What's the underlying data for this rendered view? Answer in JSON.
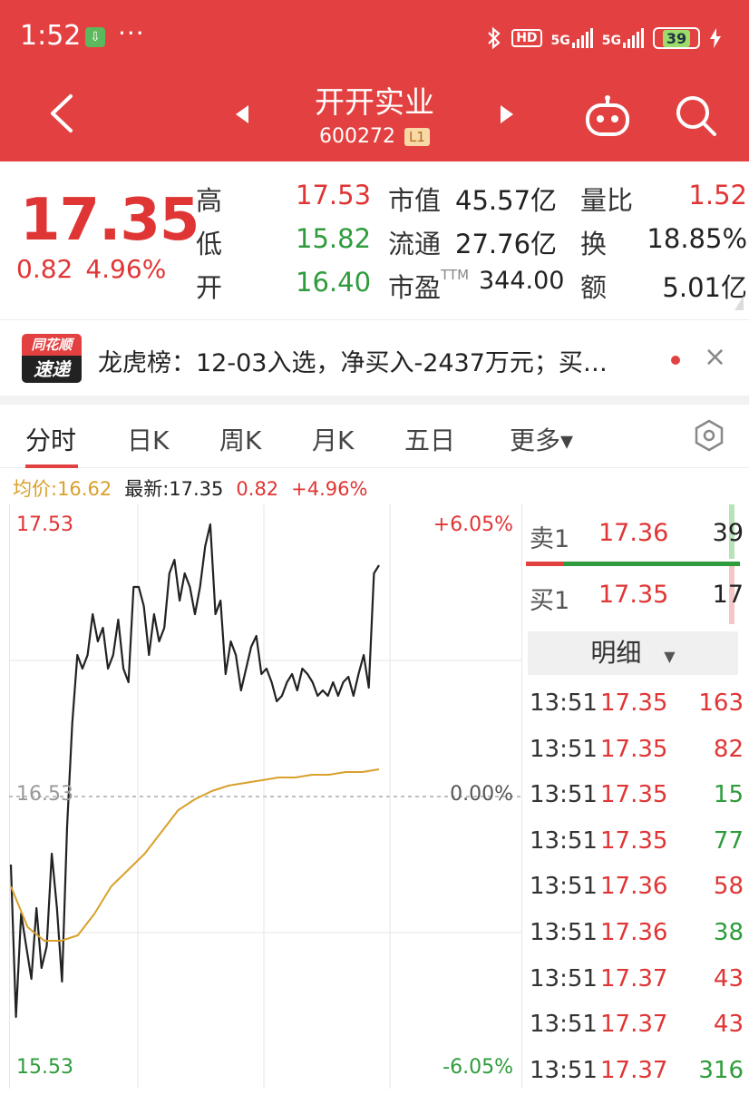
{
  "status_bar": {
    "time": "1:52",
    "battery": "39",
    "network1": "5G",
    "network2": "5G",
    "hd": "HD",
    "icons": [
      "download-icon",
      "more-dots-icon",
      "bluetooth-icon",
      "hd-icon",
      "signal-icon",
      "battery-icon",
      "charging-icon"
    ]
  },
  "header": {
    "stock_name": "开开实业",
    "stock_code": "600272",
    "level": "L1",
    "colors": {
      "header_bg": "#e34141"
    }
  },
  "quote": {
    "price": "17.35",
    "change": "0.82",
    "change_pct": "4.96%",
    "high_label": "高",
    "high": "17.53",
    "low_label": "低",
    "low": "15.82",
    "open_label": "开",
    "open": "16.40",
    "mktcap_label": "市值",
    "mktcap": "45.57亿",
    "float_label": "流通",
    "float": "27.76亿",
    "pe_label": "市盈",
    "pe_sup": "TTM",
    "pe": "344.00",
    "vol_ratio_label": "量比",
    "vol_ratio": "1.52",
    "turnover_label": "换",
    "turnover": "18.85%",
    "amount_label": "额",
    "amount": "5.01亿"
  },
  "news": {
    "logo_top": "同花顺",
    "logo_bottom": "速递",
    "text": "龙虎榜：12-03入选，净买入-2437万元；买…",
    "close": "×"
  },
  "tabs": [
    {
      "label": "分时"
    },
    {
      "label": "日K"
    },
    {
      "label": "周K"
    },
    {
      "label": "月K"
    },
    {
      "label": "五日"
    },
    {
      "label": "更多▾"
    }
  ],
  "infoline": {
    "avg_label": "均价:16.62",
    "latest_label": "最新:17.35",
    "change": "0.82",
    "change_pct": "+4.96%"
  },
  "chart_labels": {
    "y_top": "17.53",
    "y_mid": "16.53",
    "y_bottom": "15.53",
    "pct_top": "+6.05%",
    "pct_mid": "0.00%",
    "pct_bottom": "-6.05%"
  },
  "chart_data": {
    "type": "line",
    "ylim": [
      15.53,
      17.53
    ],
    "reference_price": 16.53,
    "series": [
      {
        "name": "价格",
        "color": "#222222",
        "values": [
          16.28,
          15.72,
          16.1,
          15.98,
          15.86,
          16.12,
          15.9,
          15.98,
          16.32,
          16.12,
          15.85,
          16.42,
          16.8,
          17.05,
          17.0,
          17.05,
          17.2,
          17.1,
          17.15,
          17.0,
          17.05,
          17.18,
          17.0,
          16.95,
          17.3,
          17.3,
          17.23,
          17.05,
          17.2,
          17.1,
          17.15,
          17.35,
          17.4,
          17.25,
          17.35,
          17.3,
          17.2,
          17.3,
          17.45,
          17.53,
          17.2,
          17.25,
          16.98,
          17.1,
          17.05,
          16.92,
          17.0,
          17.08,
          17.12,
          16.98,
          17.0,
          16.95,
          16.88,
          16.9,
          16.95,
          16.98,
          16.92,
          17.0,
          16.98,
          16.95,
          16.9,
          16.92,
          16.9,
          16.95,
          16.9,
          16.95,
          16.97,
          16.9,
          16.98,
          17.05,
          16.93,
          17.35,
          17.38
        ]
      },
      {
        "name": "均价",
        "color": "#d9a02c",
        "values": [
          16.2,
          16.05,
          16.0,
          16.0,
          16.02,
          16.1,
          16.2,
          16.26,
          16.32,
          16.4,
          16.48,
          16.52,
          16.55,
          16.57,
          16.58,
          16.59,
          16.6,
          16.6,
          16.61,
          16.61,
          16.62,
          16.62,
          16.63
        ]
      }
    ]
  },
  "orderbook": {
    "ask_label": "卖1",
    "ask_price": "17.36",
    "ask_vol": "39",
    "bid_label": "买1",
    "bid_price": "17.35",
    "bid_vol": "17",
    "detail_label": "明细",
    "ask_ratio": 0.18
  },
  "trades": [
    {
      "time": "13:51",
      "price": "17.35",
      "vol": "163",
      "side": "buy"
    },
    {
      "time": "13:51",
      "price": "17.35",
      "vol": "82",
      "side": "buy"
    },
    {
      "time": "13:51",
      "price": "17.35",
      "vol": "15",
      "side": "sell"
    },
    {
      "time": "13:51",
      "price": "17.35",
      "vol": "77",
      "side": "sell"
    },
    {
      "time": "13:51",
      "price": "17.36",
      "vol": "58",
      "side": "buy"
    },
    {
      "time": "13:51",
      "price": "17.36",
      "vol": "38",
      "side": "sell"
    },
    {
      "time": "13:51",
      "price": "17.37",
      "vol": "43",
      "side": "buy"
    },
    {
      "time": "13:51",
      "price": "17.37",
      "vol": "43",
      "side": "buy"
    },
    {
      "time": "13:51",
      "price": "17.37",
      "vol": "316",
      "side": "sell"
    }
  ]
}
